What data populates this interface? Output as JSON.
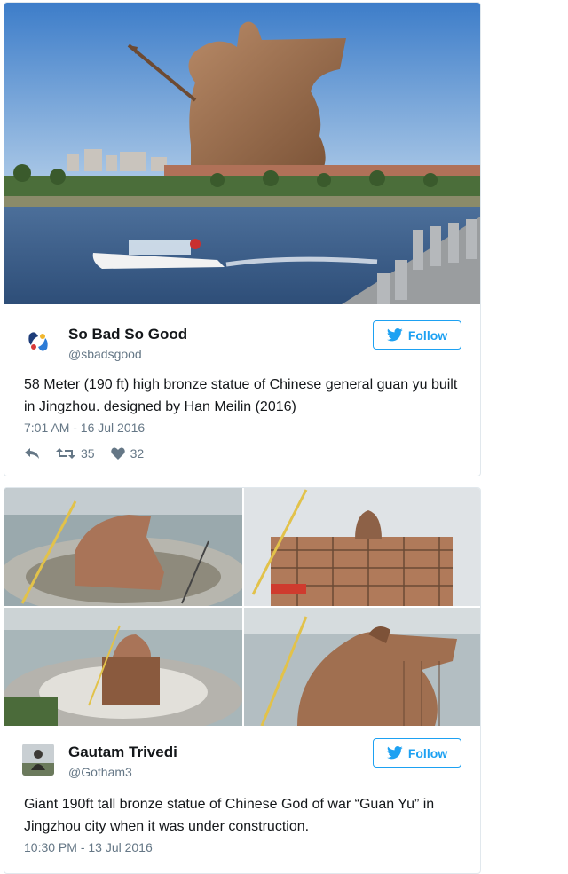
{
  "tweets": [
    {
      "name": "So Bad So Good",
      "handle": "@sbadsgood",
      "follow_label": "Follow",
      "text": "58 Meter (190 ft) high bronze statue of Chinese general guan yu built in Jingzhou. designed by Han Meilin (2016)",
      "timestamp": "7:01 AM - 16 Jul 2016",
      "retweets": "35",
      "likes": "32"
    },
    {
      "name": "Gautam Trivedi",
      "handle": "@Gotham3",
      "follow_label": "Follow",
      "text": "Giant 190ft tall bronze statue of Chinese God of war “Guan Yu” in Jingzhou city when it was under construction.",
      "timestamp": "10:30 PM - 13 Jul 2016"
    }
  ],
  "colors": {
    "twitter_blue": "#1da1f2",
    "text": "#14171a",
    "muted": "#657786"
  },
  "icons": [
    "twitter-bird-icon",
    "reply-icon",
    "retweet-icon",
    "heart-icon"
  ]
}
